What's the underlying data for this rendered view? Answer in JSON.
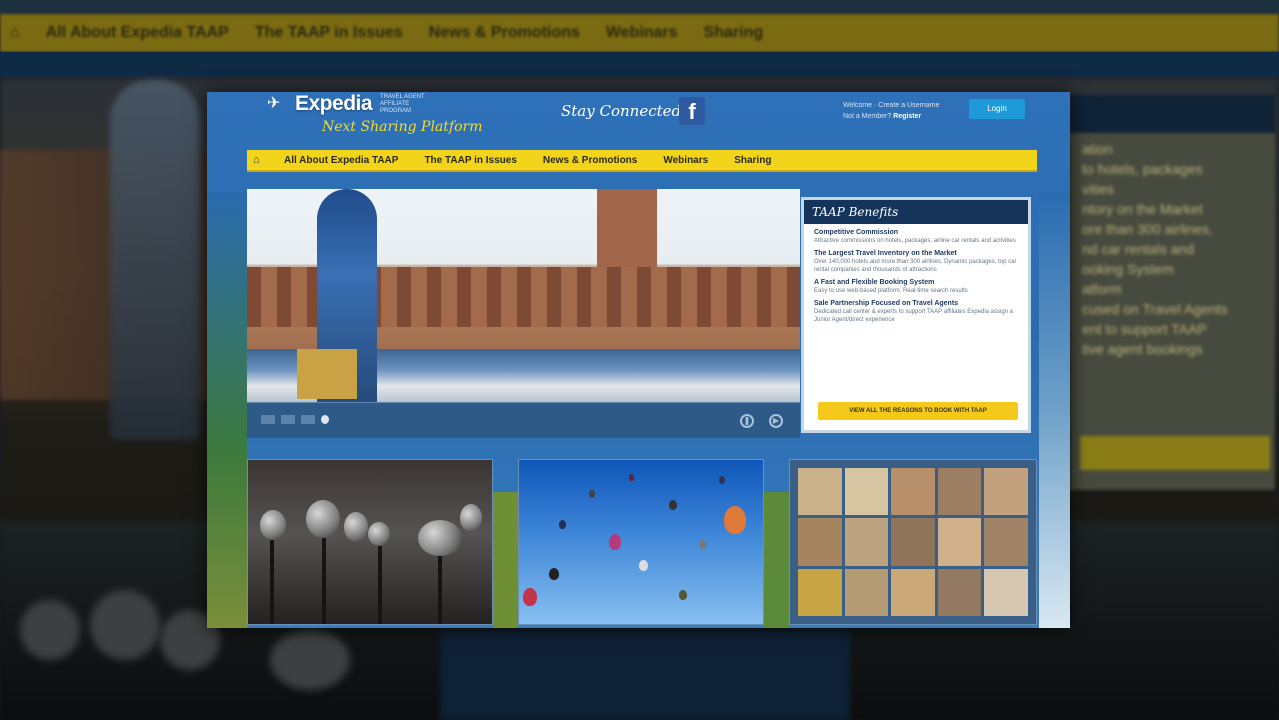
{
  "background_page": {
    "nav_items": [
      "All About Expedia TAAP",
      "The TAAP in Issues",
      "News & Promotions",
      "Webinars",
      "Sharing"
    ],
    "panel_lines": [
      "ation",
      "to hotels, packages",
      "vities",
      "ntory on the Market",
      "ore than 300 airlines,",
      "nd car rentals and",
      "ooking System",
      "atform",
      "cused on Travel Agents",
      "ent to support TAAP",
      "tive agent bookings"
    ]
  },
  "modal": {
    "logo": {
      "name": "Expedia",
      "sub": "Travel Agent Affiliate Program"
    },
    "tagline": "Next Sharing Platform",
    "stay_connected": "Stay Connected",
    "fb_letter": "f",
    "account": {
      "line1": "Welcome · Create a Username",
      "line2": "Not a Member?",
      "link": "Register"
    },
    "login_label": "Login",
    "nav": {
      "home_icon": "home-icon",
      "items": [
        "All About Expedia TAAP",
        "The TAAP in Issues",
        "News & Promotions",
        "Webinars",
        "Sharing"
      ]
    },
    "benefits": {
      "title": "TAAP Benefits",
      "blocks": [
        {
          "h": "Competitive Commission",
          "p": "Attractive commissions on hotels, packages, airline car rentals and activities"
        },
        {
          "h": "The Largest Travel Inventory on the Market",
          "p": "Over 140,000 hotels and more than 300 airlines. Dynamic packages, top car rental companies and thousands of attractions"
        },
        {
          "h": "A Fast and Flexible Booking System",
          "p": "Easy to use web-based platform. Real-time search results"
        },
        {
          "h": "Sale Partnership Focused on Travel Agents",
          "p": "Dedicated call center & experts to support TAAP affiliates Expedia assign a Junior Agent/direct experience"
        }
      ],
      "cta": "VIEW ALL THE REASONS TO BOOK WITH TAAP"
    },
    "slider": {
      "active_index": 3,
      "count": 4
    }
  }
}
